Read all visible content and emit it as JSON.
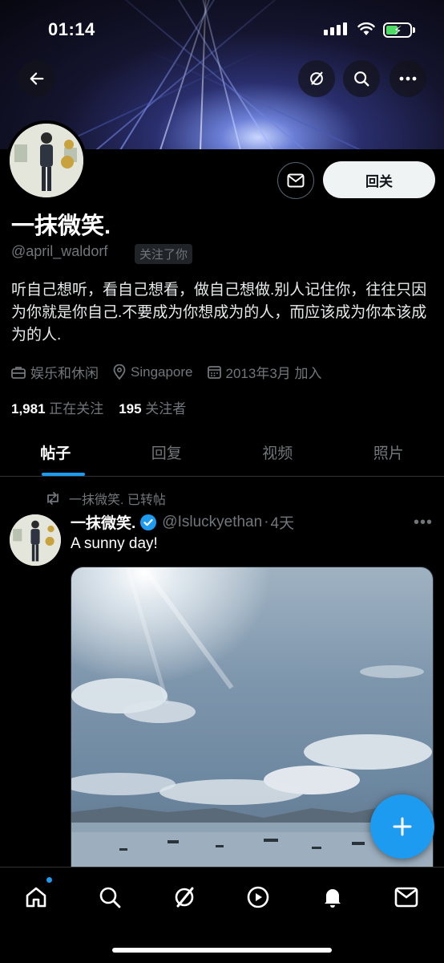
{
  "status_bar": {
    "time": "01:14"
  },
  "profile": {
    "name": "一抹微笑.",
    "handle": "@april_waldorf",
    "follows_you": "关注了你",
    "bio": "听自己想听，看自己想看，做自己想做.别人记住你，往往只因为你就是你自己.不要成为你想成为的人，而应该成为你本该成为的人.",
    "category": "娱乐和休闲",
    "location": "Singapore",
    "joined": "2013年3月 加入",
    "following_count": "1,981",
    "following_label": "正在关注",
    "followers_count": "195",
    "followers_label": "关注者",
    "follow_button": "回关"
  },
  "tabs": [
    {
      "label": "帖子",
      "active": true
    },
    {
      "label": "回复",
      "active": false
    },
    {
      "label": "视频",
      "active": false
    },
    {
      "label": "照片",
      "active": false
    }
  ],
  "post": {
    "repost_label": "一抹微笑. 已转帖",
    "author_name": "一抹微笑.",
    "author_handle": "@Isluckyethan",
    "time": "4天",
    "text": "A sunny day!",
    "image": "sky-over-harbor-photo"
  },
  "icons": {
    "back": "arrow-left-icon",
    "grok": "grok-icon",
    "search": "search-icon",
    "more": "more-icon",
    "message": "mail-icon",
    "compose": "plus-icon"
  },
  "bottom_nav": [
    "home-icon",
    "search-icon",
    "grok-icon",
    "video-icon",
    "notifications-icon",
    "messages-icon"
  ],
  "colors": {
    "accent": "#1d9bf0",
    "background": "#000000",
    "muted": "#71767b",
    "verified": "#1d9bf0"
  }
}
